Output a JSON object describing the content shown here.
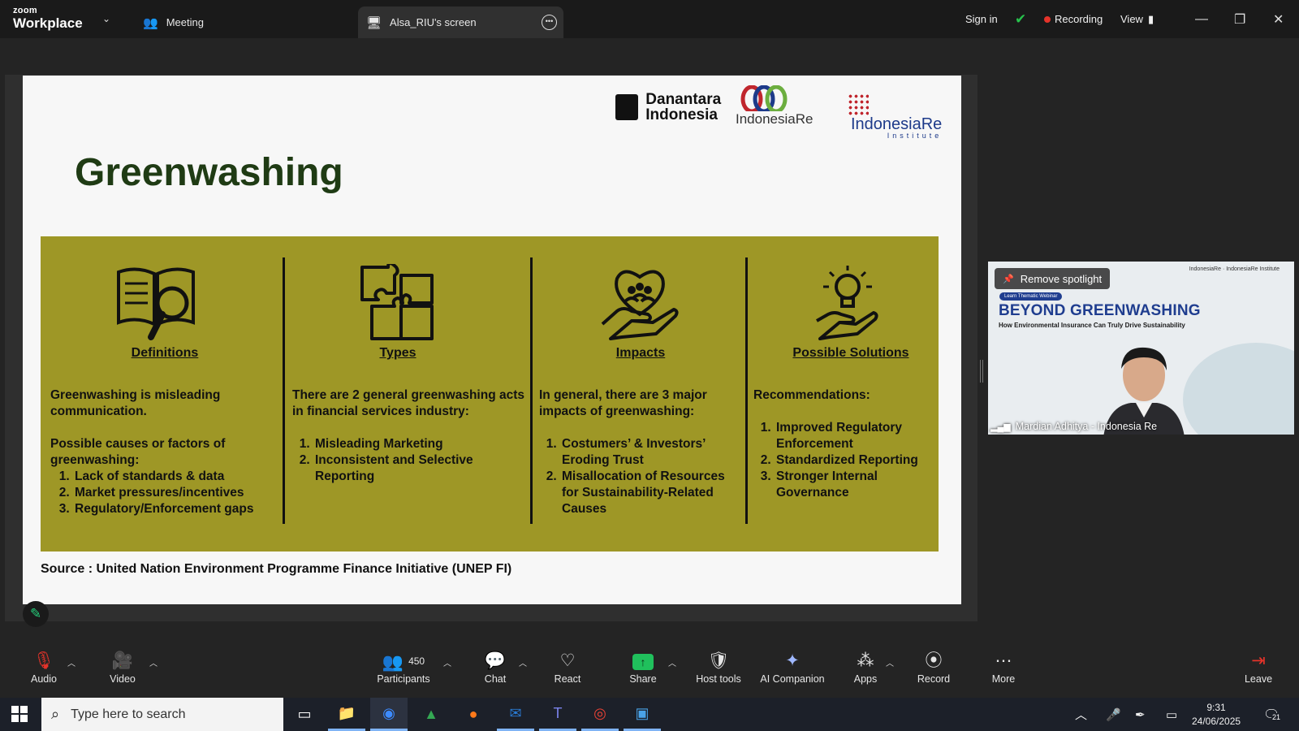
{
  "titlebar": {
    "logo_line1": "zoom",
    "logo_line2": "Workplace",
    "tab_meeting": "Meeting",
    "tab_screen": "Alsa_RIU's screen",
    "sign_in": "Sign in",
    "recording": "Recording",
    "view": "View"
  },
  "slide": {
    "title": "Greenwashing",
    "logos": {
      "danantara_line1": "Danantara",
      "danantara_line2": "Indonesia",
      "indonesiare": "IndonesiaRe",
      "institute_name": "IndonesiaRe",
      "institute_sub": "Institute"
    },
    "columns": [
      {
        "heading": "Definitions",
        "intro": "Greenwashing is misleading communication.",
        "intro2": "Possible causes or factors of greenwashing:",
        "items": [
          "Lack of standards & data",
          "Market pressures/incentives",
          "Regulatory/Enforcement gaps"
        ]
      },
      {
        "heading": "Types",
        "intro": "There are 2 general greenwashing acts in financial services industry:",
        "items": [
          "Misleading Marketing",
          "Inconsistent and Selective Reporting"
        ]
      },
      {
        "heading": "Impacts",
        "intro": "In general, there are 3 major impacts of greenwashing:",
        "items": [
          "Costumers’ & Investors’ Eroding Trust",
          "Misallocation of Resources for  Sustainability-Related Causes"
        ]
      },
      {
        "heading": "Possible Solutions",
        "intro": "Recommendations:",
        "items": [
          "Improved Regulatory Enforcement",
          "Standardized Reporting",
          "Stronger Internal Governance"
        ]
      }
    ],
    "source": "Source : United Nation Environment Programme Finance Initiative (UNEP FI)"
  },
  "spotlight": {
    "remove_label": "Remove spotlight",
    "participant_name": "Mardian Adhitya - Indonesia Re",
    "video_badge": "Learn Thematic Webinar",
    "video_title": "BEYOND GREENWASHING",
    "video_subtitle": "How Environmental Insurance Can Truly Drive Sustainability",
    "video_logos": "IndonesiaRe  ·  IndonesiaRe Institute"
  },
  "toolbar": {
    "audio": "Audio",
    "video": "Video",
    "participants": "Participants",
    "participants_count": "450",
    "chat": "Chat",
    "react": "React",
    "share": "Share",
    "host_tools": "Host tools",
    "ai_companion": "AI Companion",
    "apps": "Apps",
    "record": "Record",
    "more": "More",
    "leave": "Leave"
  },
  "taskbar": {
    "search_placeholder": "Type here to search",
    "time": "9:31",
    "date": "24/06/2025",
    "notifications": "21"
  },
  "colors": {
    "panel": "#9e9726",
    "title_green": "#1f3b14",
    "accent_green": "#20c05c",
    "record_red": "#e5332a"
  }
}
